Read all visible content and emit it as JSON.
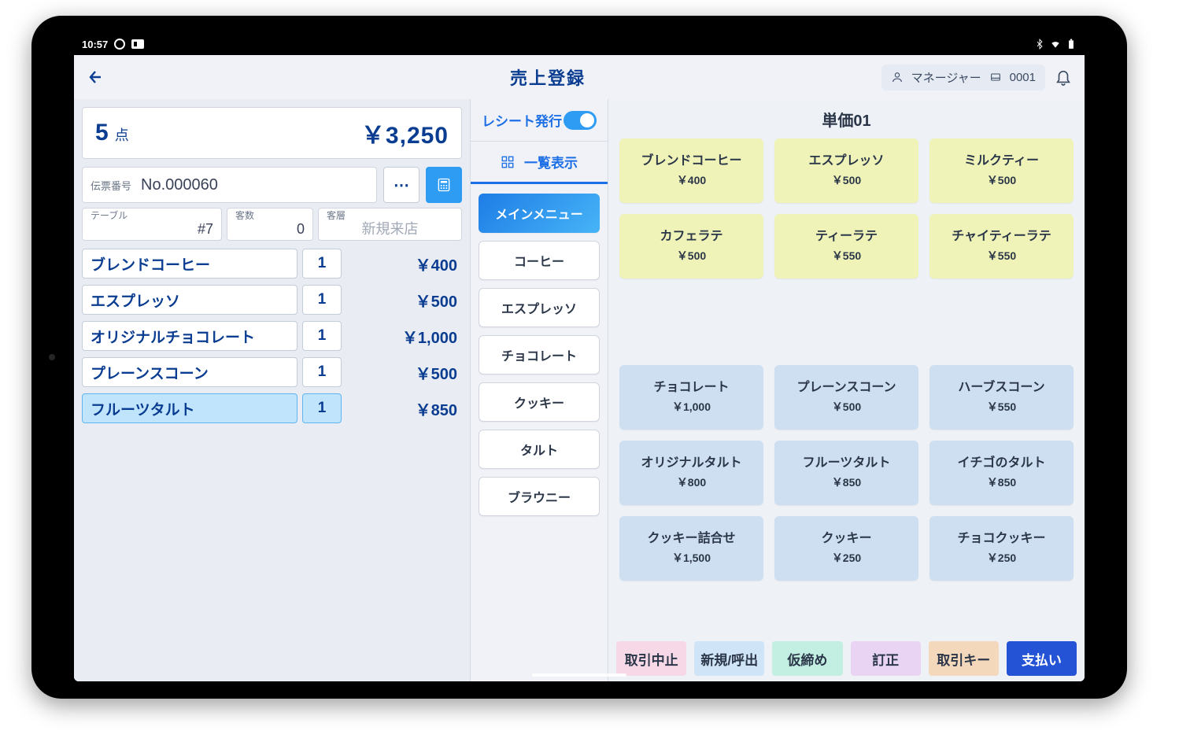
{
  "status_bar": {
    "time": "10:57"
  },
  "header": {
    "title": "売上登録",
    "user_role": "マネージャー",
    "register_no": "0001"
  },
  "ticket": {
    "item_count": "5",
    "item_unit": "点",
    "total_display": "￥3,250",
    "slip_label": "伝票番号",
    "slip_no": "No.000060",
    "table_label": "テーブル",
    "table_value": "#7",
    "guests_label": "客数",
    "guests_value": "0",
    "guest_class_label": "客層",
    "guest_class_placeholder": "新規来店",
    "lines": [
      {
        "name": "ブレンドコーヒー",
        "qty": "1",
        "price": "￥400",
        "selected": false
      },
      {
        "name": "エスプレッソ",
        "qty": "1",
        "price": "￥500",
        "selected": false
      },
      {
        "name": "オリジナルチョコレート",
        "qty": "1",
        "price": "￥1,000",
        "selected": false
      },
      {
        "name": "プレーンスコーン",
        "qty": "1",
        "price": "￥500",
        "selected": false
      },
      {
        "name": "フルーツタルト",
        "qty": "1",
        "price": "￥850",
        "selected": true
      }
    ]
  },
  "mid": {
    "receipt_toggle_label": "レシート発行",
    "list_view_label": "一覧表示",
    "categories": [
      {
        "label": "メインメニュー",
        "active": true
      },
      {
        "label": "コーヒー",
        "active": false
      },
      {
        "label": "エスプレッソ",
        "active": false
      },
      {
        "label": "チョコレート",
        "active": false
      },
      {
        "label": "クッキー",
        "active": false
      },
      {
        "label": "タルト",
        "active": false
      },
      {
        "label": "ブラウニー",
        "active": false
      }
    ]
  },
  "products": {
    "header": "単価01",
    "items": [
      {
        "name": "ブレンドコーヒー",
        "price": "￥400",
        "variant": "green"
      },
      {
        "name": "エスプレッソ",
        "price": "￥500",
        "variant": "green"
      },
      {
        "name": "ミルクティー",
        "price": "￥500",
        "variant": "green"
      },
      {
        "name": "カフェラテ",
        "price": "￥500",
        "variant": "green"
      },
      {
        "name": "ティーラテ",
        "price": "￥550",
        "variant": "green"
      },
      {
        "name": "チャイティーラテ",
        "price": "￥550",
        "variant": "green"
      },
      {
        "variant": "spacer"
      },
      {
        "variant": "spacer"
      },
      {
        "variant": "spacer"
      },
      {
        "name": "チョコレート",
        "price": "￥1,000",
        "variant": "blue"
      },
      {
        "name": "プレーンスコーン",
        "price": "￥500",
        "variant": "blue"
      },
      {
        "name": "ハーブスコーン",
        "price": "￥550",
        "variant": "blue"
      },
      {
        "name": "オリジナルタルト",
        "price": "￥800",
        "variant": "blue"
      },
      {
        "name": "フルーツタルト",
        "price": "￥850",
        "variant": "blue"
      },
      {
        "name": "イチゴのタルト",
        "price": "￥850",
        "variant": "blue"
      },
      {
        "name": "クッキー詰合せ",
        "price": "￥1,500",
        "variant": "blue"
      },
      {
        "name": "クッキー",
        "price": "￥250",
        "variant": "blue"
      },
      {
        "name": "チョコクッキー",
        "price": "￥250",
        "variant": "blue"
      }
    ]
  },
  "actions": {
    "cancel": "取引中止",
    "recall": "新規/呼出",
    "hold": "仮締め",
    "correct": "訂正",
    "txn_key": "取引キー",
    "pay": "支払い"
  }
}
